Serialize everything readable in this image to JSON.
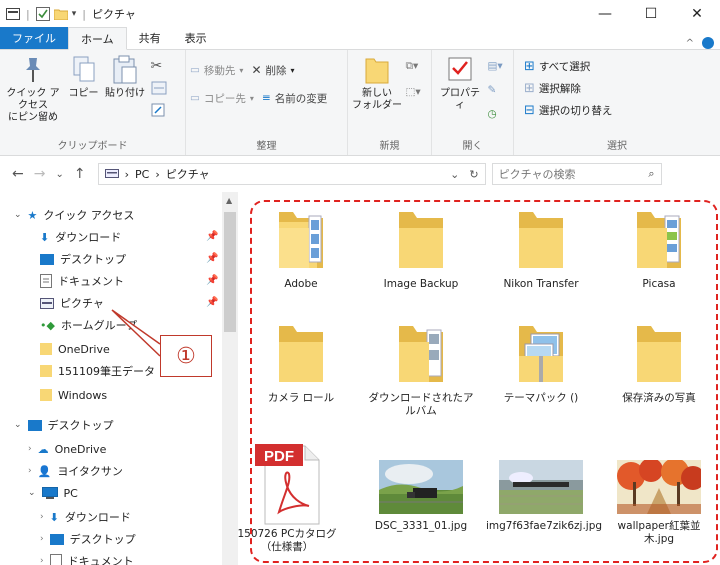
{
  "window": {
    "title": "ピクチャ",
    "controls": {
      "minimize": "—",
      "maximize": "☐",
      "close": "✕"
    }
  },
  "tabs": {
    "file": "ファイル",
    "home": "ホーム",
    "share": "共有",
    "view": "表示"
  },
  "ribbon": {
    "clipboard": {
      "pin": "クイック アクセス\nにピン留め",
      "copy": "コピー",
      "paste": "貼り付け",
      "label": "クリップボード"
    },
    "organize": {
      "move": "移動先",
      "delete": "削除",
      "copyto": "コピー先",
      "rename": "名前の変更",
      "label": "整理"
    },
    "new": {
      "folder": "新しい\nフォルダー",
      "label": "新規"
    },
    "open": {
      "properties": "プロパティ",
      "label": "開く"
    },
    "select": {
      "all": "すべて選択",
      "none": "選択解除",
      "invert": "選択の切り替え",
      "label": "選択"
    }
  },
  "address": {
    "nav": {
      "back": "←",
      "forward": "→",
      "recent": "⌄",
      "up": "↑"
    },
    "crumbs": [
      "PC",
      "ピクチャ"
    ],
    "search_placeholder": "ピクチャの検索"
  },
  "navpane": {
    "quick_access": "クイック アクセス",
    "items": [
      "ダウンロード",
      "デスクトップ",
      "ドキュメント",
      "ピクチャ",
      "ホームグループ",
      "OneDrive",
      "151109筆王データ",
      "Windows"
    ],
    "desktop": "デスクトップ",
    "desktop_children": [
      "OneDrive",
      "ヨイタクサン",
      "PC"
    ],
    "pc_children": [
      "ダウンロード",
      "デスクトップ",
      "ドキュメント"
    ]
  },
  "files": [
    "Adobe",
    "Image Backup",
    "Nikon Transfer",
    "Picasa",
    "カメラ ロール",
    "ダウンロードされたアルバム",
    "テーマパック ()",
    "保存済みの写真",
    "150726 PCカタログ（仕様書）",
    "DSC_3331_01.jpg",
    "img7f63fae7zik6zj.jpg",
    "wallpaper紅葉並木.jpg"
  ],
  "pdf_badge": "PDF",
  "callout": "①",
  "colors": {
    "accent": "#1979ca",
    "annotation": "#e0221f",
    "folder": "#f8d775",
    "folder_dark": "#e5b94a"
  }
}
